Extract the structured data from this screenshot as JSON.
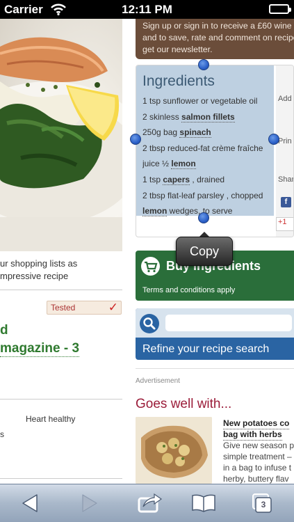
{
  "status_bar": {
    "carrier": "Carrier",
    "time": "12:11 PM",
    "battery_level": 1.0
  },
  "left_column": {
    "text_lines": [
      "ur shopping lists as",
      "mpressive recipe"
    ],
    "tested_badge": "Tested",
    "link_line_1": "d",
    "link_line_2": "magazine - 3",
    "heart_healthy": "Heart healthy",
    "stub_char": "s"
  },
  "signup": {
    "lines": [
      "Sign up or sign in to receive a £60 wine",
      "and to save, rate and comment on recipe",
      "get our newsletter."
    ]
  },
  "ingredients": {
    "title": "Ingredients",
    "items": [
      {
        "pre": "1 tsp sunflower or vegetable oil",
        "bold": "",
        "post": ""
      },
      {
        "pre": "2 skinless ",
        "bold": "salmon fillets",
        "post": ""
      },
      {
        "pre": "250g bag ",
        "bold": "spinach",
        "post": ""
      },
      {
        "pre": "2 tbsp reduced-fat crème fraîche",
        "bold": "",
        "post": ""
      },
      {
        "pre": "juice ½ ",
        "bold": "lemon",
        "post": ""
      },
      {
        "pre": "1 tsp ",
        "bold": "capers",
        "post": " , drained"
      },
      {
        "pre": "2 tbsp flat-leaf parsley , chopped",
        "bold": "",
        "post": ""
      },
      {
        "pre": "",
        "bold": "lemon",
        "post": " wedges, to serve"
      }
    ]
  },
  "side_panel": {
    "add": "Add t",
    "print": "Prin",
    "share": "Shar",
    "facebook": "f",
    "gplus": "+1"
  },
  "copy_menu": {
    "label": "Copy"
  },
  "buy_ingredients": {
    "label": "Buy ingredients",
    "terms": "Terms and conditions apply"
  },
  "search": {
    "value": "",
    "placeholder": "",
    "refine_label": "Refine your recipe search"
  },
  "advertisement_label": "Advertisement",
  "goes_well": {
    "heading": "Goes well with...",
    "recipe_title_lines": [
      "New potatoes co",
      "bag with herbs"
    ],
    "recipe_desc_lines": [
      "Give new season p",
      "simple treatment –",
      "in a bag to infuse t",
      "herby, buttery flav"
    ]
  },
  "toolbar": {
    "tabs_count": "3",
    "icons": [
      "back-icon",
      "forward-icon",
      "share-icon",
      "bookmarks-icon",
      "tabs-icon"
    ]
  },
  "colors": {
    "signup_bg": "#6b4d3a",
    "selection": "#bed0e1",
    "buy_green": "#2a6e3a",
    "search_blue": "#2a64a3",
    "heading_red": "#9b1d3a",
    "link_green": "#2f7a2f"
  }
}
